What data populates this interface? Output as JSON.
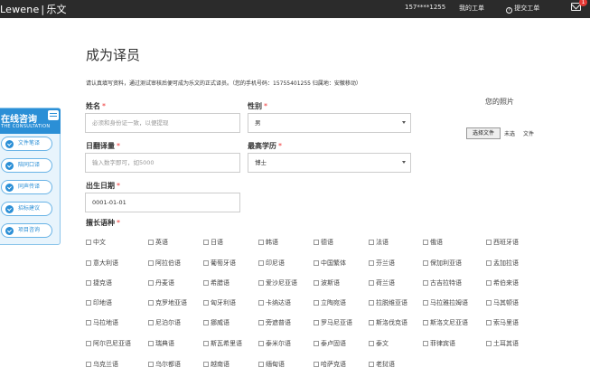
{
  "header": {
    "logo": {
      "brand": "Lewene",
      "separator": "|",
      "name": "乐文"
    },
    "user_phone": "157****1255",
    "my_orders": "我的工单",
    "submit_order": "提交工单",
    "mail_badge": "1"
  },
  "page": {
    "title": "成为译员",
    "notice": "请认真填写资料，通过测试审核后便可成为乐文的正式译员。（您的手机号码：15755401255  归属地：安徽移动）"
  },
  "form": {
    "name": {
      "label": "姓名",
      "required": "*",
      "placeholder": "必须和身份证一致，以便提现"
    },
    "gender": {
      "label": "性别",
      "required": "*",
      "value": "男"
    },
    "daily_output": {
      "label": "日翻译量",
      "required": "*",
      "placeholder": "输入数字即可，如5000"
    },
    "education": {
      "label": "最高学历",
      "required": "*",
      "value": "博士"
    },
    "birth_date": {
      "label": "出生日期",
      "required": "*",
      "value": "0001-01-01"
    },
    "languages_label": {
      "label": "擅长语种",
      "required": "*"
    }
  },
  "photo": {
    "title": "您的照片",
    "choose_button": "选择文件",
    "status": "未选",
    "file_label": "文件"
  },
  "languages": [
    [
      "中文",
      "英语",
      "日语",
      "韩语",
      "德语",
      "法语",
      "俄语",
      "西班牙语"
    ],
    [
      "意大利语",
      "阿拉伯语",
      "葡萄牙语",
      "印尼语",
      "中国繁体",
      "芬兰语",
      "保加利亚语",
      "孟加拉语"
    ],
    [
      "捷克语",
      "丹麦语",
      "希腊语",
      "爱沙尼亚语",
      "波斯语",
      "荷兰语",
      "古吉拉特语",
      "希伯来语"
    ],
    [
      "印地语",
      "克罗地亚语",
      "匈牙利语",
      "卡纳达语",
      "立陶宛语",
      "拉脱维亚语",
      "马拉雅拉姆语",
      "马其顿语"
    ],
    [
      "马拉地语",
      "尼泊尔语",
      "挪威语",
      "旁遮普语",
      "罗马尼亚语",
      "斯洛伐克语",
      "斯洛文尼亚语",
      "索马里语"
    ],
    [
      "阿尔巴尼亚语",
      "瑞典语",
      "斯瓦希里语",
      "泰米尔语",
      "泰卢固语",
      "泰文",
      "菲律宾语",
      "土耳其语"
    ],
    [
      "乌克兰语",
      "乌尔都语",
      "越南语",
      "缅甸语",
      "哈萨克语",
      "老挝语"
    ]
  ],
  "consult": {
    "title": "在线咨询",
    "subtitle": "THE CONSULTATION",
    "items": [
      "文件笔译",
      "陪同口译",
      "同声传译",
      "招标建议",
      "项目咨询"
    ]
  }
}
